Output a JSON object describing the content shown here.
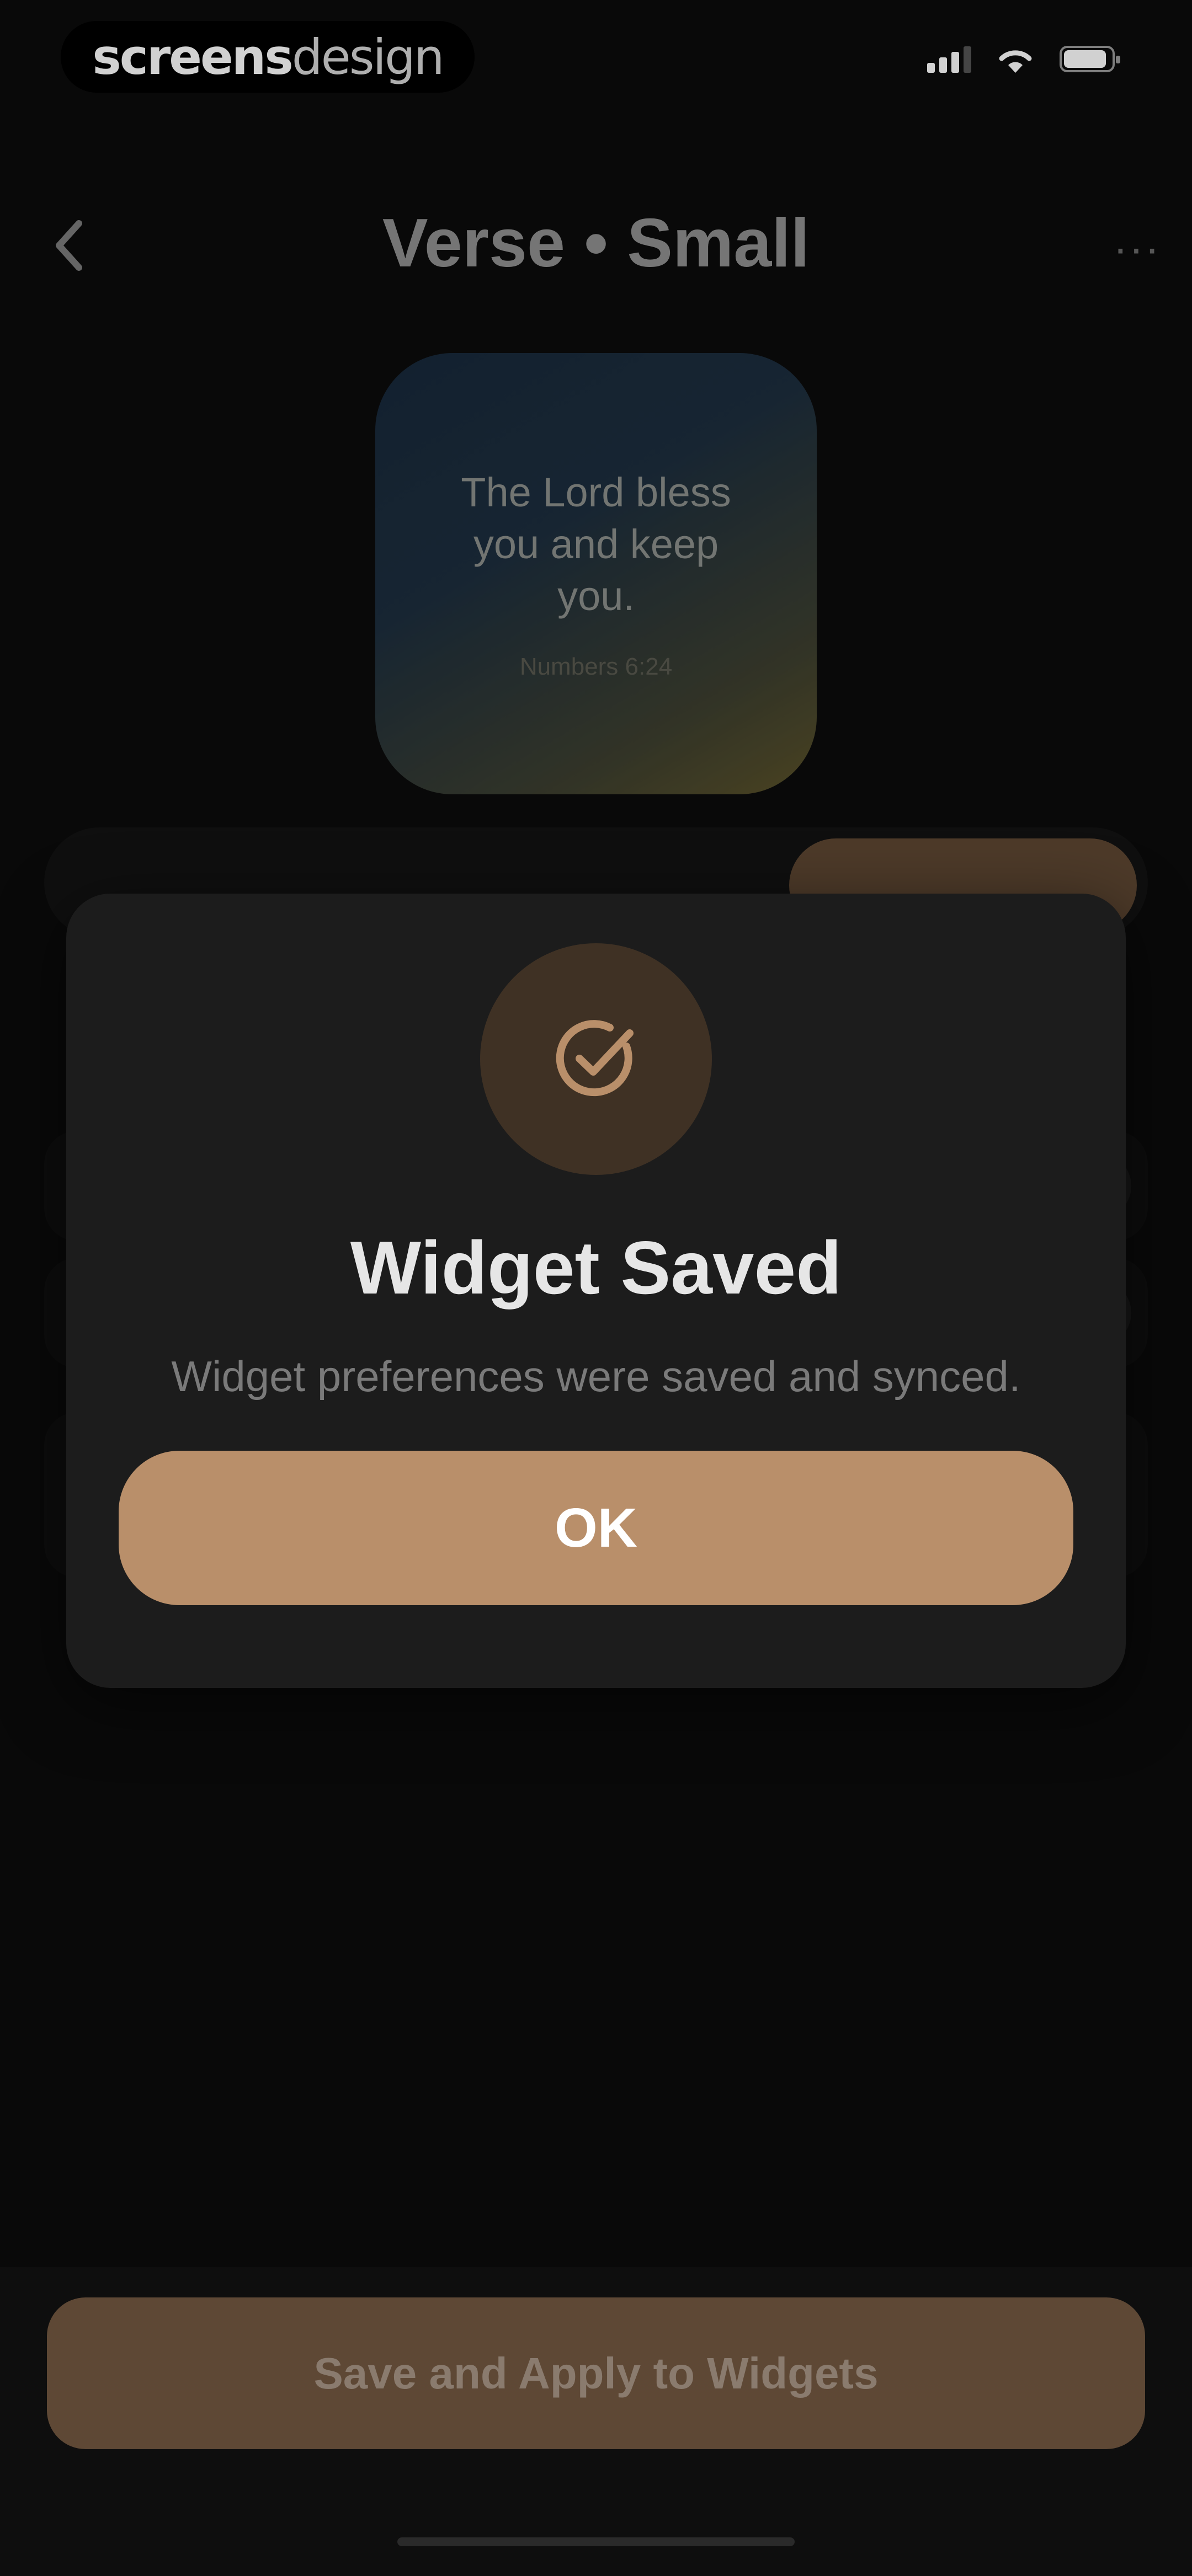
{
  "status_bar": {
    "brand_primary": "screens",
    "brand_secondary": "design",
    "signal_icon": "cellular-signal-icon",
    "wifi_icon": "wifi-icon",
    "battery_icon": "battery-icon"
  },
  "header": {
    "title": "Verse • Small",
    "back_icon": "chevron-left-icon",
    "more_icon": "more-horizontal-icon",
    "more_glyph": "···"
  },
  "preview": {
    "verse": "The Lord bless you and keep you.",
    "reference": "Numbers 6:24"
  },
  "modal": {
    "icon": "check-circle-icon",
    "title": "Widget Saved",
    "message": "Widget preferences were saved and synced.",
    "ok_label": "OK"
  },
  "footer": {
    "save_label": "Save and Apply to Widgets"
  },
  "colors": {
    "background": "#0b0b0b",
    "accent": "#b98f6a",
    "modal_surface": "#1c1c1c",
    "icon_circle": "#3f3124",
    "disabled_button": "#5e4835"
  }
}
